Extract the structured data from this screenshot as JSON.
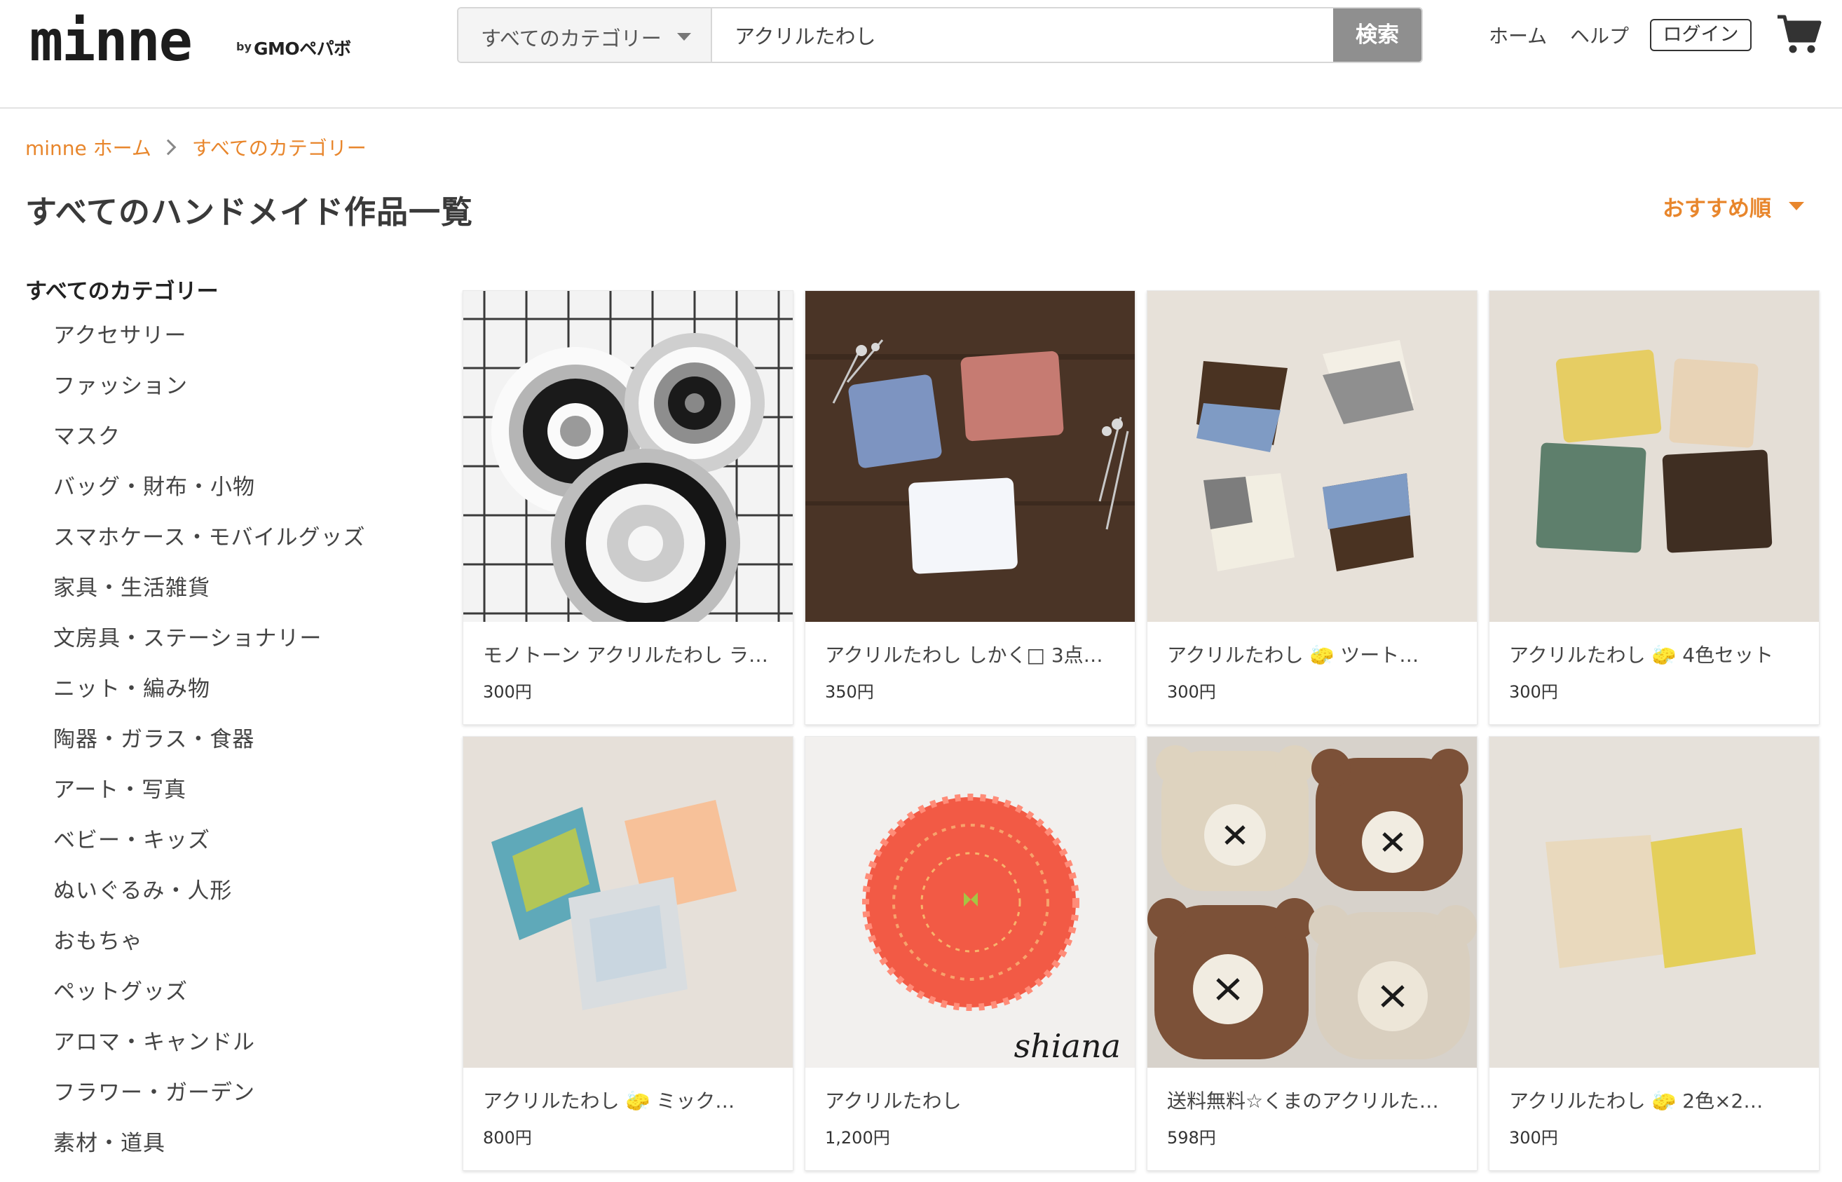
{
  "header": {
    "logo": "minne",
    "by": "by",
    "sponsor": "GMOペパボ",
    "search": {
      "category": "すべてのカテゴリー",
      "query": "アクリルたわし",
      "button": "検索"
    },
    "nav": {
      "home": "ホーム",
      "help": "ヘルプ",
      "login": "ログイン"
    },
    "cart_icon": "cart-icon"
  },
  "breadcrumb": [
    {
      "label": "minne ホーム"
    },
    {
      "label": "すべてのカテゴリー"
    }
  ],
  "page": {
    "title": "すべてのハンドメイド作品一覧",
    "sort": "おすすめ順"
  },
  "colors": {
    "accent": "#e8862c",
    "search_button": "#8f8f8f",
    "text": "#333333"
  },
  "sidebar": {
    "heading": "すべてのカテゴリー",
    "items": [
      {
        "label": "アクセサリー"
      },
      {
        "label": "ファッション"
      },
      {
        "label": "マスク"
      },
      {
        "label": "バッグ・財布・小物"
      },
      {
        "label": "スマホケース・モバイルグッズ"
      },
      {
        "label": "家具・生活雑貨"
      },
      {
        "label": "文房具・ステーショナリー"
      },
      {
        "label": "ニット・編み物"
      },
      {
        "label": "陶器・ガラス・食器"
      },
      {
        "label": "アート・写真"
      },
      {
        "label": "ベビー・キッズ"
      },
      {
        "label": "ぬいぐるみ・人形"
      },
      {
        "label": "おもちゃ"
      },
      {
        "label": "ペットグッズ"
      },
      {
        "label": "アロマ・キャンドル"
      },
      {
        "label": "フラワー・ガーデン"
      },
      {
        "label": "素材・道具"
      }
    ]
  },
  "products": [
    {
      "title": "モノトーン アクリルたわし ラ…",
      "price": "300円"
    },
    {
      "title": "アクリルたわし しかく□ 3点…",
      "price": "350円"
    },
    {
      "title": "アクリルたわし 🧽 ツート…",
      "price": "300円"
    },
    {
      "title": "アクリルたわし 🧽 4色セット",
      "price": "300円"
    },
    {
      "title": "アクリルたわし 🧽 ミック…",
      "price": "800円"
    },
    {
      "title": "アクリルたわし",
      "price": "1,200円",
      "watermark": "shiana"
    },
    {
      "title": "送料無料☆くまのアクリルた…",
      "price": "598円"
    },
    {
      "title": "アクリルたわし 🧽 2色×2…",
      "price": "300円"
    }
  ]
}
